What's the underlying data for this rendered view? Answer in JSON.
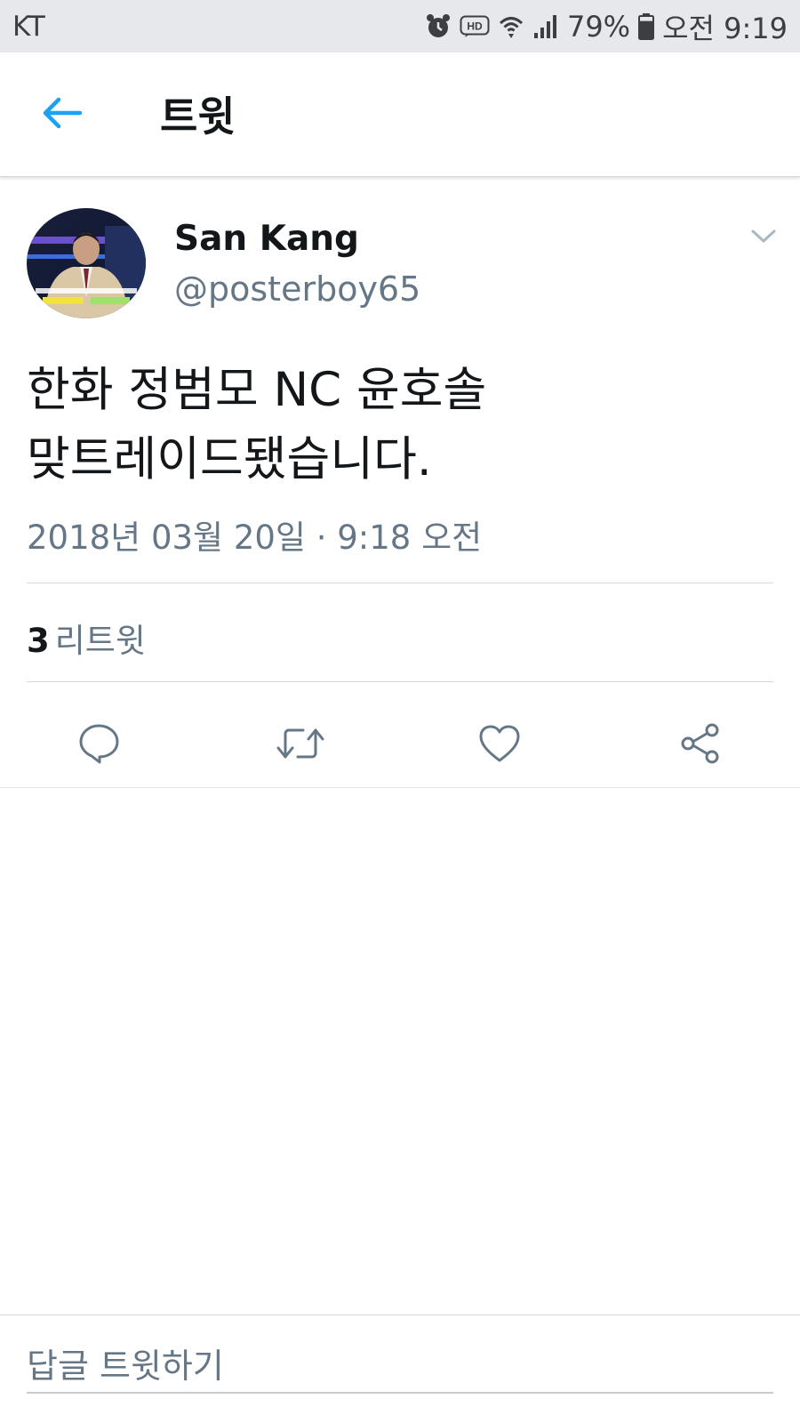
{
  "status_bar": {
    "carrier": "KT",
    "hd_badge": "HD",
    "battery": "79%",
    "time": "오전 9:19",
    "icons": [
      "alarm-icon",
      "hd-voice-icon",
      "wifi-icon",
      "signal-icon",
      "battery-icon"
    ],
    "battery_level": 0.79
  },
  "header": {
    "title": "트윗",
    "back_icon": "arrow-left-icon"
  },
  "tweet": {
    "display_name": "San Kang",
    "handle": "@posterboy65",
    "text_lines": [
      "한화 정범모 NC 윤호솔",
      "맞트레이드됐습니다."
    ],
    "timestamp": "2018년 03월 20일 · 9:18 오전",
    "retweet_count": "3",
    "retweet_label": "리트윗"
  },
  "actions": [
    {
      "name": "reply",
      "icon": "reply-icon"
    },
    {
      "name": "retweet",
      "icon": "retweet-icon"
    },
    {
      "name": "like",
      "icon": "heart-icon"
    },
    {
      "name": "share",
      "icon": "share-icon"
    }
  ],
  "reply_bar": {
    "placeholder": "답글 트윗하기"
  },
  "colors": {
    "accent": "#1da1f2",
    "text_primary": "#14171a",
    "text_secondary": "#657786",
    "status_bar_bg": "#e6e8eb",
    "divider": "#d6d9dc"
  }
}
